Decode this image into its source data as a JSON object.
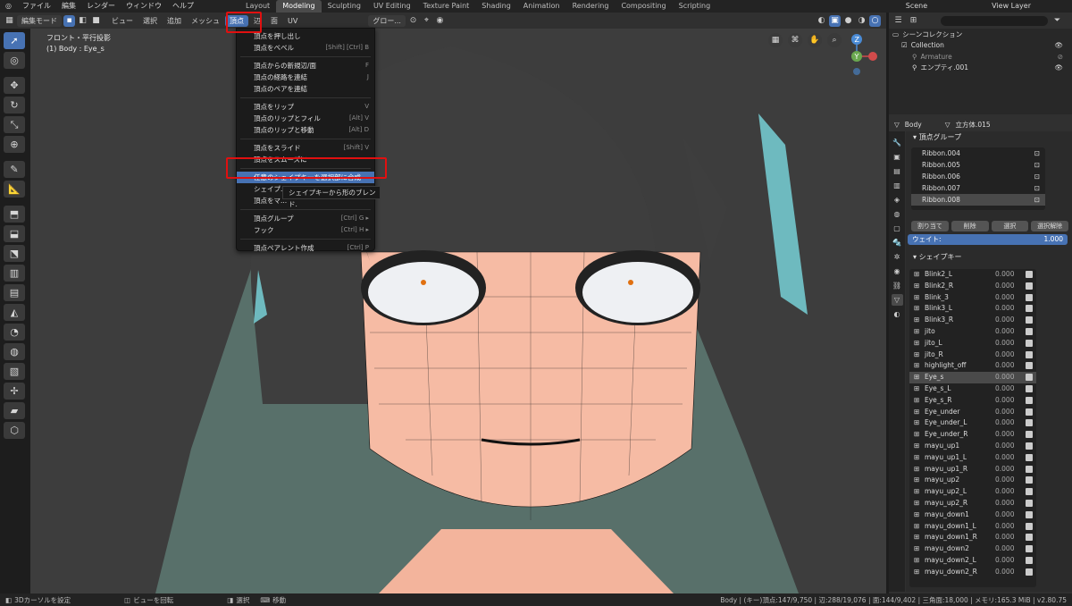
{
  "topbar": {
    "menus": [
      "ファイル",
      "編集",
      "レンダー",
      "ウィンドウ",
      "ヘルプ"
    ],
    "tabs": [
      "Layout",
      "Modeling",
      "Sculpting",
      "UV Editing",
      "Texture Paint",
      "Shading",
      "Animation",
      "Rendering",
      "Compositing",
      "Scripting"
    ],
    "active_tab": "Modeling",
    "scene": "Scene",
    "view_layer": "View Layer"
  },
  "header": {
    "mode": "編集モード",
    "menus": [
      "ビュー",
      "選択",
      "追加",
      "メッシュ",
      "頂点",
      "辺",
      "面",
      "UV"
    ],
    "active_menu": "頂点",
    "orientation": "グロー..."
  },
  "viewport": {
    "info_line1": "フロント・平行投影",
    "info_line2": "(1) Body : Eye_s",
    "gizmo_z": "Z",
    "gizmo_y": "Y"
  },
  "vertex_menu": {
    "items": [
      {
        "label": "頂点を押し出し",
        "shortcut": ""
      },
      {
        "label": "頂点をベベル",
        "shortcut": "[Shift] [Ctrl] B"
      },
      {
        "sep": true
      },
      {
        "label": "頂点からの新規辺/面",
        "shortcut": "F"
      },
      {
        "label": "頂点の経路を連結",
        "shortcut": "J"
      },
      {
        "label": "頂点のペアを連結",
        "shortcut": ""
      },
      {
        "sep": true
      },
      {
        "label": "頂点をリップ",
        "shortcut": "V"
      },
      {
        "label": "頂点のリップとフィル",
        "shortcut": "[Alt] V"
      },
      {
        "label": "頂点のリップと移動",
        "shortcut": "[Alt] D"
      },
      {
        "sep": true
      },
      {
        "label": "頂点をスライド",
        "shortcut": "[Shift] V"
      },
      {
        "label": "頂点をスムーズに",
        "shortcut": ""
      },
      {
        "sep": true
      },
      {
        "label": "任意のシェイプキーを選択部に合成",
        "shortcut": "",
        "highlight": true
      },
      {
        "label": "シェイプ...",
        "shortcut": ""
      },
      {
        "label": "頂点をマ...",
        "shortcut": ""
      },
      {
        "sep": true
      },
      {
        "label": "頂点グループ",
        "shortcut": "[Ctrl] G ▸"
      },
      {
        "label": "フック",
        "shortcut": "[Ctrl] H ▸"
      },
      {
        "sep": true
      },
      {
        "label": "頂点ペアレント作成",
        "shortcut": "[Ctrl] P"
      }
    ],
    "tooltip": "シェイプキーから形のブレンド."
  },
  "outliner": {
    "title": "シーンコレクション",
    "collection": "Collection",
    "armature": "Armature",
    "empty": "エンプティ.001"
  },
  "properties": {
    "object": "Body",
    "mesh": "立方体.015",
    "vgroups_title": "頂点グループ",
    "vgroups": [
      "Ribbon.004",
      "Ribbon.005",
      "Ribbon.006",
      "Ribbon.007",
      "Ribbon.008"
    ],
    "vgroup_selected": "Ribbon.008",
    "buttons": [
      "割り当て",
      "削除",
      "選択",
      "選択解除"
    ],
    "weight_label": "ウェイト:",
    "weight_value": "1.000",
    "shapekeys_title": "シェイプキー",
    "shapekeys": [
      "Blink2_L",
      "Blink2_R",
      "Blink_3",
      "Blink3_L",
      "Blink3_R",
      "jito",
      "jito_L",
      "jito_R",
      "highlight_off",
      "Eye_s",
      "Eye_s_L",
      "Eye_s_R",
      "Eye_under",
      "Eye_under_L",
      "Eye_under_R",
      "mayu_up1",
      "mayu_up1_L",
      "mayu_up1_R",
      "mayu_up2",
      "mayu_up2_L",
      "mayu_up2_R",
      "mayu_down1",
      "mayu_down1_L",
      "mayu_down1_R",
      "mayu_down2",
      "mayu_down2_L",
      "mayu_down2_R"
    ],
    "shapekey_value": "0.000",
    "shapekey_selected": "Eye_s"
  },
  "status": {
    "left1": "3Dカーソルを設定",
    "left2": "ビューを回転",
    "left3": "選択",
    "left4": "移動",
    "right": "Body | (キー)頂点:147/9,750 | 辺:288/19,076 | 面:144/9,402 | 三角面:18,000 | メモリ:165.3 MiB | v2.80.75"
  },
  "colors": {
    "accent": "#4772b3",
    "highlight_box": "#e01010",
    "skin": "#f4b9a2",
    "hair": "#3e3e3e"
  }
}
